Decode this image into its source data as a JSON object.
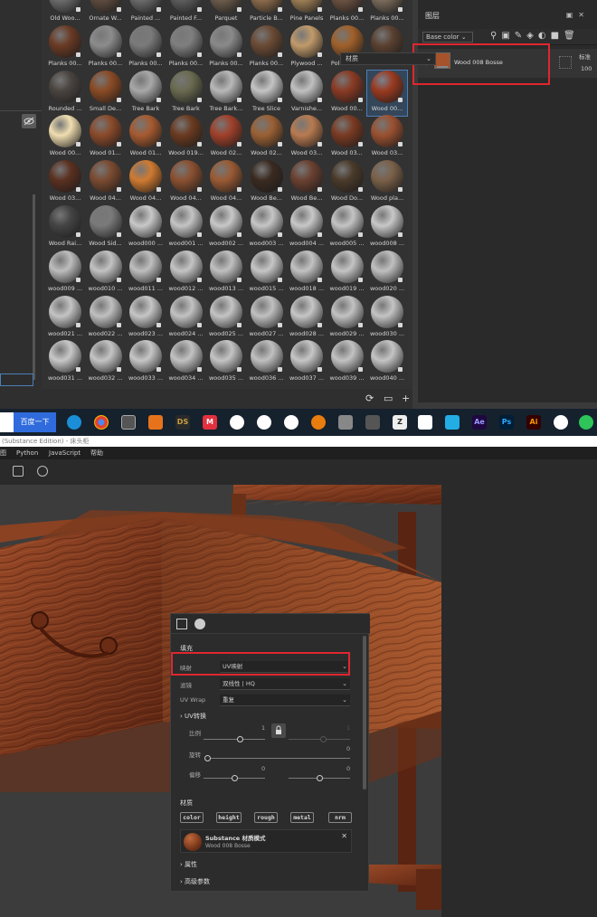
{
  "shelf": {
    "materials": [
      {
        "label": "Old Woo...",
        "color": "#6b6b6b"
      },
      {
        "label": "Ornate W...",
        "color": "#5d4a3e"
      },
      {
        "label": "Painted ...",
        "color": "#6a6a6a"
      },
      {
        "label": "Painted F...",
        "color": "#5c5c5c"
      },
      {
        "label": "Parquet",
        "color": "#6a5a4a"
      },
      {
        "label": "Particle B...",
        "color": "#8a6a4a"
      },
      {
        "label": "Pine Panels",
        "color": "#9b7d54"
      },
      {
        "label": "Planks 00...",
        "color": "#6a5040"
      },
      {
        "label": "Planks 00...",
        "color": "#7a6a5a"
      },
      {
        "label": "Planks 00...",
        "color": "#6a3a24"
      },
      {
        "label": "Planks 00...",
        "color": "#8c8c8c"
      },
      {
        "label": "Planks 00...",
        "color": "#7a7a7a"
      },
      {
        "label": "Planks 00...",
        "color": "#7f7f7f"
      },
      {
        "label": "Planks 00...",
        "color": "#8a8a8a"
      },
      {
        "label": "Planks 00...",
        "color": "#6a4a34"
      },
      {
        "label": "Plywood ...",
        "color": "#c09a6a"
      },
      {
        "label": "Polished ...",
        "color": "#a0602a"
      },
      {
        "label": "Reinforce...",
        "color": "#5a4030"
      },
      {
        "label": "Rounded ...",
        "color": "#4a4440"
      },
      {
        "label": "Small De...",
        "color": "#8a4a24"
      },
      {
        "label": "Tree Bark",
        "color": "#a8a8a8"
      },
      {
        "label": "Tree Bark",
        "color": "#6a6a50"
      },
      {
        "label": "Tree Bark...",
        "color": "#b8b8b8"
      },
      {
        "label": "Tree Slice",
        "color": "#c4c4c4"
      },
      {
        "label": "Varnishe...",
        "color": "#c0c0c0"
      },
      {
        "label": "Wood 00...",
        "color": "#8a3a24"
      },
      {
        "label": "Wood 00...",
        "color": "#9a3a20"
      },
      {
        "label": "Wood 00...",
        "color": "#f0deb0"
      },
      {
        "label": "Wood 01...",
        "color": "#8a4a2a"
      },
      {
        "label": "Wood 01...",
        "color": "#a65a30"
      },
      {
        "label": "Wood 019...",
        "color": "#6a3a20"
      },
      {
        "label": "Wood 02...",
        "color": "#a0402a"
      },
      {
        "label": "Wood 02...",
        "color": "#9a6034"
      },
      {
        "label": "Wood 03...",
        "color": "#b87a50"
      },
      {
        "label": "Wood 03...",
        "color": "#7a3a22"
      },
      {
        "label": "Wood 03...",
        "color": "#9a5030"
      },
      {
        "label": "Wood 03...",
        "color": "#5a3020"
      },
      {
        "label": "Wood 04...",
        "color": "#7a4a30"
      },
      {
        "label": "Wood 04...",
        "color": "#d07a30"
      },
      {
        "label": "Wood 04...",
        "color": "#8a5030"
      },
      {
        "label": "Wood 04...",
        "color": "#9a5a34"
      },
      {
        "label": "Wood Be...",
        "color": "#3a2a20"
      },
      {
        "label": "Wood Be...",
        "color": "#6a4030"
      },
      {
        "label": "Wood Do...",
        "color": "#4a3a2a"
      },
      {
        "label": "Wood pla...",
        "color": "#7a6048"
      },
      {
        "label": "Wood Rai...",
        "color": "#444444"
      },
      {
        "label": "Wood Sid...",
        "color": "#7a7a7a"
      },
      {
        "label": "wood000 ...",
        "color": "#c8c8c8"
      },
      {
        "label": "wood001 ...",
        "color": "#c4c4c4"
      },
      {
        "label": "wood002 ...",
        "color": "#c8c8c8"
      },
      {
        "label": "wood003 ...",
        "color": "#c6c6c6"
      },
      {
        "label": "wood004 ...",
        "color": "#c8c8c8"
      },
      {
        "label": "wood005 ...",
        "color": "#c4c4c4"
      },
      {
        "label": "wood008 ...",
        "color": "#c8c8c8"
      },
      {
        "label": "wood009 ...",
        "color": "#bdbdbd"
      },
      {
        "label": "wood010 ...",
        "color": "#c2c2c2"
      },
      {
        "label": "wood011 ...",
        "color": "#bebebe"
      },
      {
        "label": "wood012 ...",
        "color": "#c4c4c4"
      },
      {
        "label": "wood013 ...",
        "color": "#c0c0c0"
      },
      {
        "label": "wood015 ...",
        "color": "#c6c6c6"
      },
      {
        "label": "wood018 ...",
        "color": "#c2c2c2"
      },
      {
        "label": "wood019 ...",
        "color": "#c4c4c4"
      },
      {
        "label": "wood020 ...",
        "color": "#c0c0c0"
      },
      {
        "label": "wood021 ...",
        "color": "#c4c4c4"
      },
      {
        "label": "wood022 ...",
        "color": "#c0c0c0"
      },
      {
        "label": "wood023 ...",
        "color": "#c6c6c6"
      },
      {
        "label": "wood024 ...",
        "color": "#c2c2c2"
      },
      {
        "label": "wood025 ...",
        "color": "#c4c4c4"
      },
      {
        "label": "wood027 ...",
        "color": "#c0c0c0"
      },
      {
        "label": "wood028 ...",
        "color": "#c6c6c6"
      },
      {
        "label": "wood029 ...",
        "color": "#c2c2c2"
      },
      {
        "label": "wood030 ...",
        "color": "#c4c4c4"
      },
      {
        "label": "wood031 ...",
        "color": "#c8c8c8"
      },
      {
        "label": "wood032 ...",
        "color": "#c4c4c4"
      },
      {
        "label": "wood033 ...",
        "color": "#c6c6c6"
      },
      {
        "label": "wood034 ...",
        "color": "#c2c2c2"
      },
      {
        "label": "wood035 ...",
        "color": "#c4c4c4"
      },
      {
        "label": "wood036 ...",
        "color": "#c0c0c0"
      },
      {
        "label": "wood037 ...",
        "color": "#c6c6c6"
      },
      {
        "label": "wood039 ...",
        "color": "#c2c2c2"
      },
      {
        "label": "wood040 ...",
        "color": "#c4c4c4"
      }
    ],
    "selected_index": 26
  },
  "layers": {
    "title": "图层",
    "channel": "Base color",
    "layer_name": "Wood 008 Bosse",
    "blend": "标准",
    "opacity": "100"
  },
  "taskbar": {
    "baidu_button": "百度一下",
    "apps": [
      "edge",
      "chrome",
      "app",
      "marmoset",
      "ds",
      "m",
      "unity",
      "unreal",
      "unreal2",
      "blender",
      "mixer",
      "zbrush",
      "capcut",
      "bilibili",
      "ae",
      "ps",
      "ai",
      "qq",
      "wechat"
    ]
  },
  "app": {
    "title": "(Substance Edition) - 床头柜",
    "menus": [
      "Python",
      "JavaScript",
      "帮助"
    ],
    "viewport_select": "材质"
  },
  "props": {
    "fill_section": "填充",
    "projection_label": "映射",
    "projection_value": "UV映射",
    "filter_label": "滤镜",
    "filter_value": "双线性 | HQ",
    "uvwrap_label": "UV Wrap",
    "uvwrap_value": "重复",
    "uv_transform": "UV转换",
    "scale_label": "比例",
    "scale_value": "1",
    "scale_value2": "1",
    "rotate_label": "旋转",
    "rotate_value": "0",
    "offset_label": "偏移",
    "offset_value1": "0",
    "offset_value2": "0",
    "material_section": "材质",
    "channels": [
      "color",
      "height",
      "rough",
      "metal",
      "nrm"
    ],
    "mat_title": "Substance 材质模式",
    "mat_name": "Wood 008 Bosse",
    "attributes": "属性",
    "advanced": "高级参数"
  }
}
